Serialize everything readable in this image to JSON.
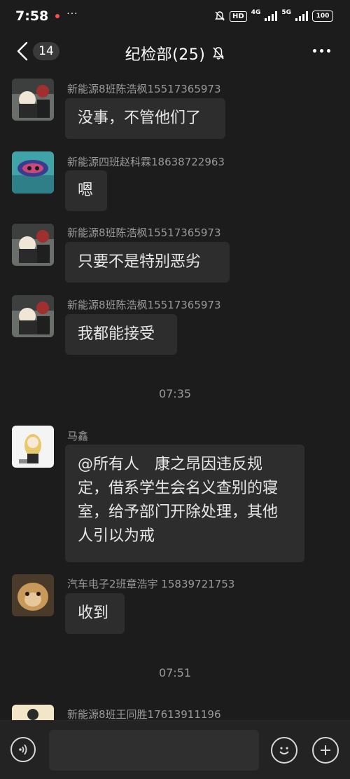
{
  "status_bar": {
    "time": "7:58",
    "dots": "···",
    "hd": "HD",
    "net1": "4G",
    "net2": "5G",
    "battery": "100"
  },
  "header": {
    "unread_count": "14",
    "title": "纪检部(25)"
  },
  "messages": [
    {
      "sender": "新能源8班陈浩枫15517365973",
      "text": "没事，不管他们了"
    },
    {
      "sender": "新能源四班赵科霖18638722963",
      "text": "嗯"
    },
    {
      "sender": "新能源8班陈浩枫15517365973",
      "text": "只要不是特别恶劣"
    },
    {
      "sender": "新能源8班陈浩枫15517365973",
      "text": "我都能接受"
    },
    {
      "sender": "马鑫",
      "lines": [
        "@所有人　康之昂因违反规",
        "定，借系学生会名义查别的寝",
        "室，给予部门开除处理，其他",
        "人引以为戒"
      ]
    },
    {
      "sender": "汽车电子2班章浩宇 15839721753",
      "text": "收到"
    },
    {
      "sender": "新能源8班王同胜17613911196",
      "text": ""
    }
  ],
  "timestamps": [
    "07:35",
    "07:51"
  ],
  "input": {
    "placeholder": ""
  },
  "colors": {
    "background": "#1c1c1c",
    "bubble": "#2d2d2d",
    "sender": "#9a9a9a",
    "text": "#e8e8e8"
  }
}
